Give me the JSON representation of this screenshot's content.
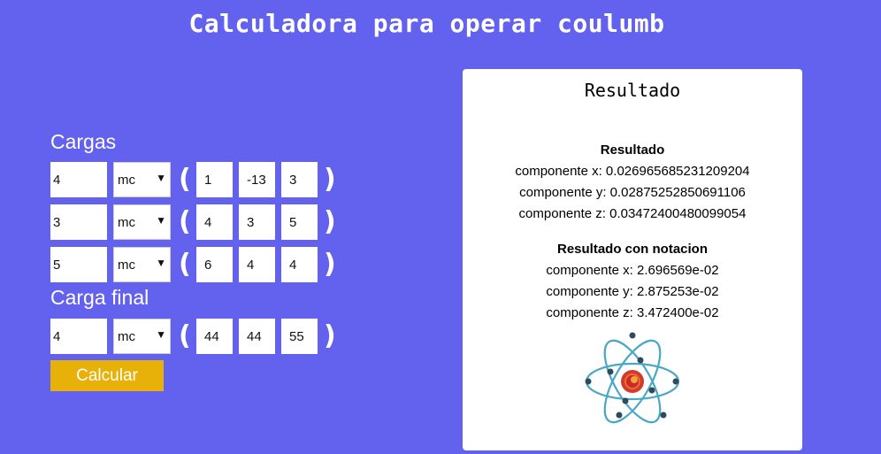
{
  "title": "Calculadora para operar coulumb",
  "cargas_label": "Cargas",
  "carga_final_label": "Carga final",
  "charges": [
    {
      "q": "4",
      "unit": "mc",
      "x": "1",
      "y": "-13",
      "z": "3"
    },
    {
      "q": "3",
      "unit": "mc",
      "x": "4",
      "y": "3",
      "z": "5"
    },
    {
      "q": "5",
      "unit": "mc",
      "x": "6",
      "y": "4",
      "z": "4"
    }
  ],
  "final_charge": {
    "q": "4",
    "unit": "mc",
    "x": "44",
    "y": "44",
    "z": "55"
  },
  "paren_open": "(",
  "paren_close": ")",
  "calc_button": "Calcular",
  "panel": {
    "title": "Resultado",
    "result_heading": "Resultado",
    "result_lines": [
      "componente x: 0.026965685231209204",
      "componente y: 0.02875252850691106",
      "componente z: 0.03472400480099054"
    ],
    "notation_heading": "Resultado con notacion",
    "notation_lines": [
      "componente x: 2.696569e-02",
      "componente y: 2.875253e-02",
      "componente z: 3.472400e-02"
    ]
  },
  "colors": {
    "background": "#6262ee",
    "button": "#e8b10a",
    "panel": "#ffffff"
  },
  "icons": {
    "atom": "atom-icon",
    "dropdown": "chevron-down-icon"
  }
}
